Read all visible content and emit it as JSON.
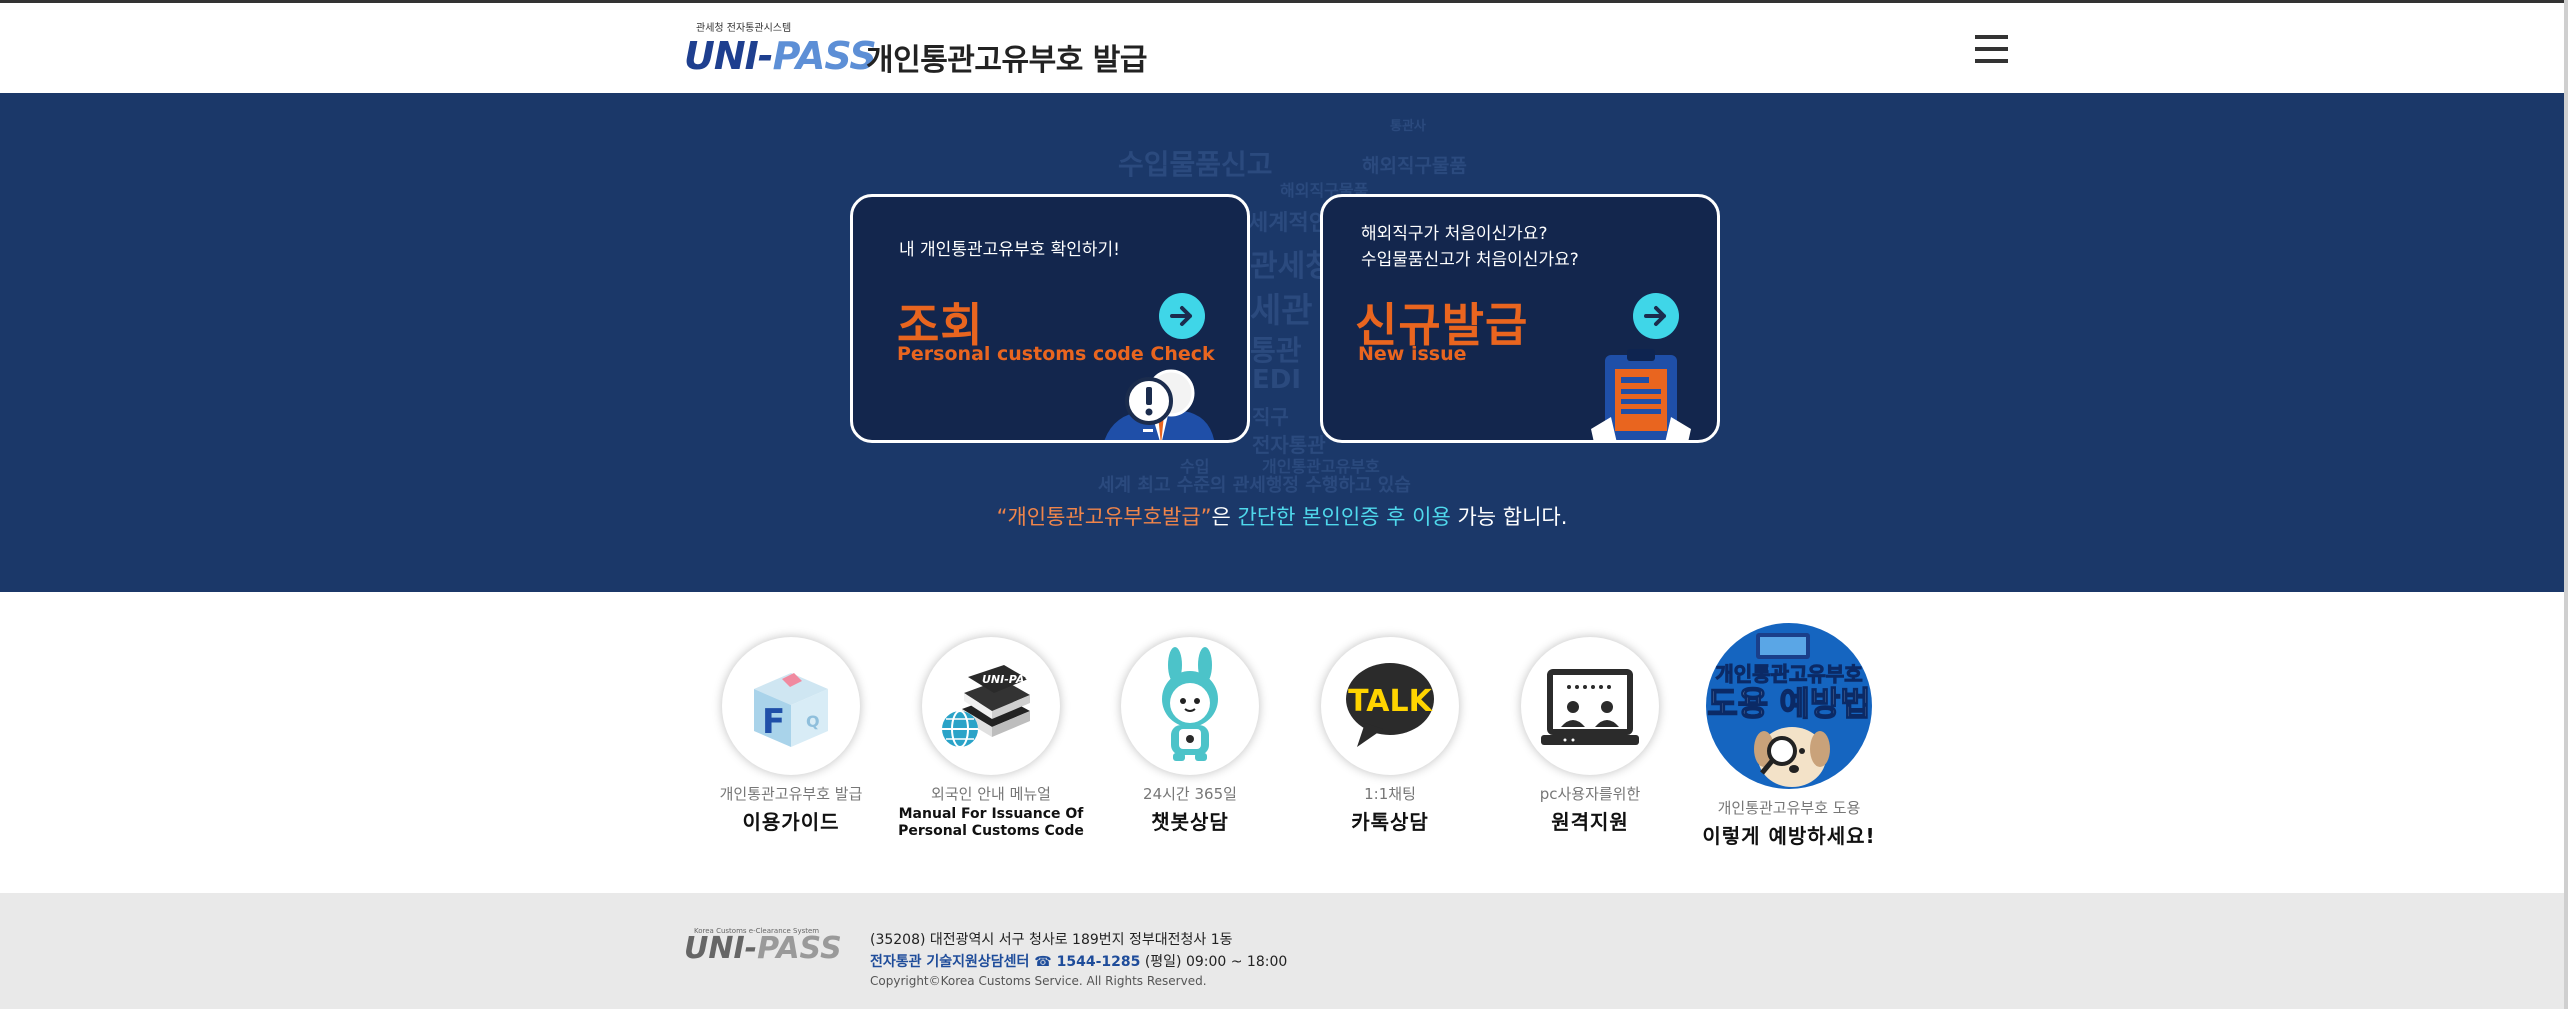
{
  "header": {
    "logo_small": "관세청 전자통관시스템",
    "logo_uni": "UNI-",
    "logo_pass": "PASS",
    "title": "개인통관고유부호  발급",
    "menu_icon": "hamburger-menu-icon"
  },
  "hero": {
    "background_words": [
      "수입물품신고",
      "해외직구물품",
      "해외직구물품",
      "세계적인 관세청",
      "관세청",
      "세관",
      "통관",
      "EDI",
      "직구",
      "전자통관",
      "수입",
      "개인통관고유부호",
      "세계 최고 수준의 관세행정 수행하고 있습",
      "통관사"
    ],
    "cards": [
      {
        "subtitle": "내 개인통관고유부호 확인하기!",
        "title": "조회",
        "subtitle_en": "Personal customs code Check",
        "arrow_icon": "arrow-right-icon",
        "illustration": "magnifier-person-icon"
      },
      {
        "subtitle": "해외직구가 처음이신가요?\n수입물품신고가 처음이신가요?",
        "title": "신규발급",
        "subtitle_en": "New issue",
        "arrow_icon": "arrow-right-icon",
        "illustration": "clipboard-document-icon"
      }
    ],
    "note_quote": "“개인통관고유부호발급”",
    "note_mid": "은 ",
    "note_highlight": "간단한 본인인증 후 이용",
    "note_end": " 가능 합니다."
  },
  "services": [
    {
      "small": "개인통관고유부호 발급",
      "main": "이용가이드",
      "icon": "faq-cube-icon"
    },
    {
      "small": "외국인 안내 메뉴얼",
      "eng": "Manual For Issuance Of Personal Customs Code",
      "icon": "manual-books-globe-icon"
    },
    {
      "small": "24시간 365일",
      "main": "챗봇상담",
      "icon": "chatbot-rabbit-icon"
    },
    {
      "small": "1:1채팅",
      "main": "카톡상담",
      "icon": "kakao-talk-icon",
      "badge": "TALK"
    },
    {
      "small": "pc사용자를위한",
      "main": "원격지원",
      "icon": "remote-support-monitor-icon"
    },
    {
      "small": "개인통관고유부호 도용",
      "main": "이렇게 예방하세요!",
      "icon": "theft-prevention-dog-icon",
      "banner_line1": "개인통관고유부호",
      "banner_line2": "도용 예방법"
    }
  ],
  "footer": {
    "logo_small": "Korea Customs e-Clearance System",
    "logo_uni": "UNI-",
    "logo_pass": "PASS",
    "address": "(35208) 대전광역시 서구 청사로 189번지 정부대전청사 1동",
    "center": "전자통관 기술지원상담센터 ☎ 1544-1285",
    "hours": " (평일) 09:00 ~ 18:00",
    "copyright": "Copyright©Korea Customs Service. All Rights Reserved."
  },
  "colors": {
    "hero_bg": "#1b3869",
    "card_bg": "#13264d",
    "accent_orange": "#e9651f",
    "accent_cyan": "#3fd6e8",
    "footer_bg": "#e9e9e9"
  }
}
